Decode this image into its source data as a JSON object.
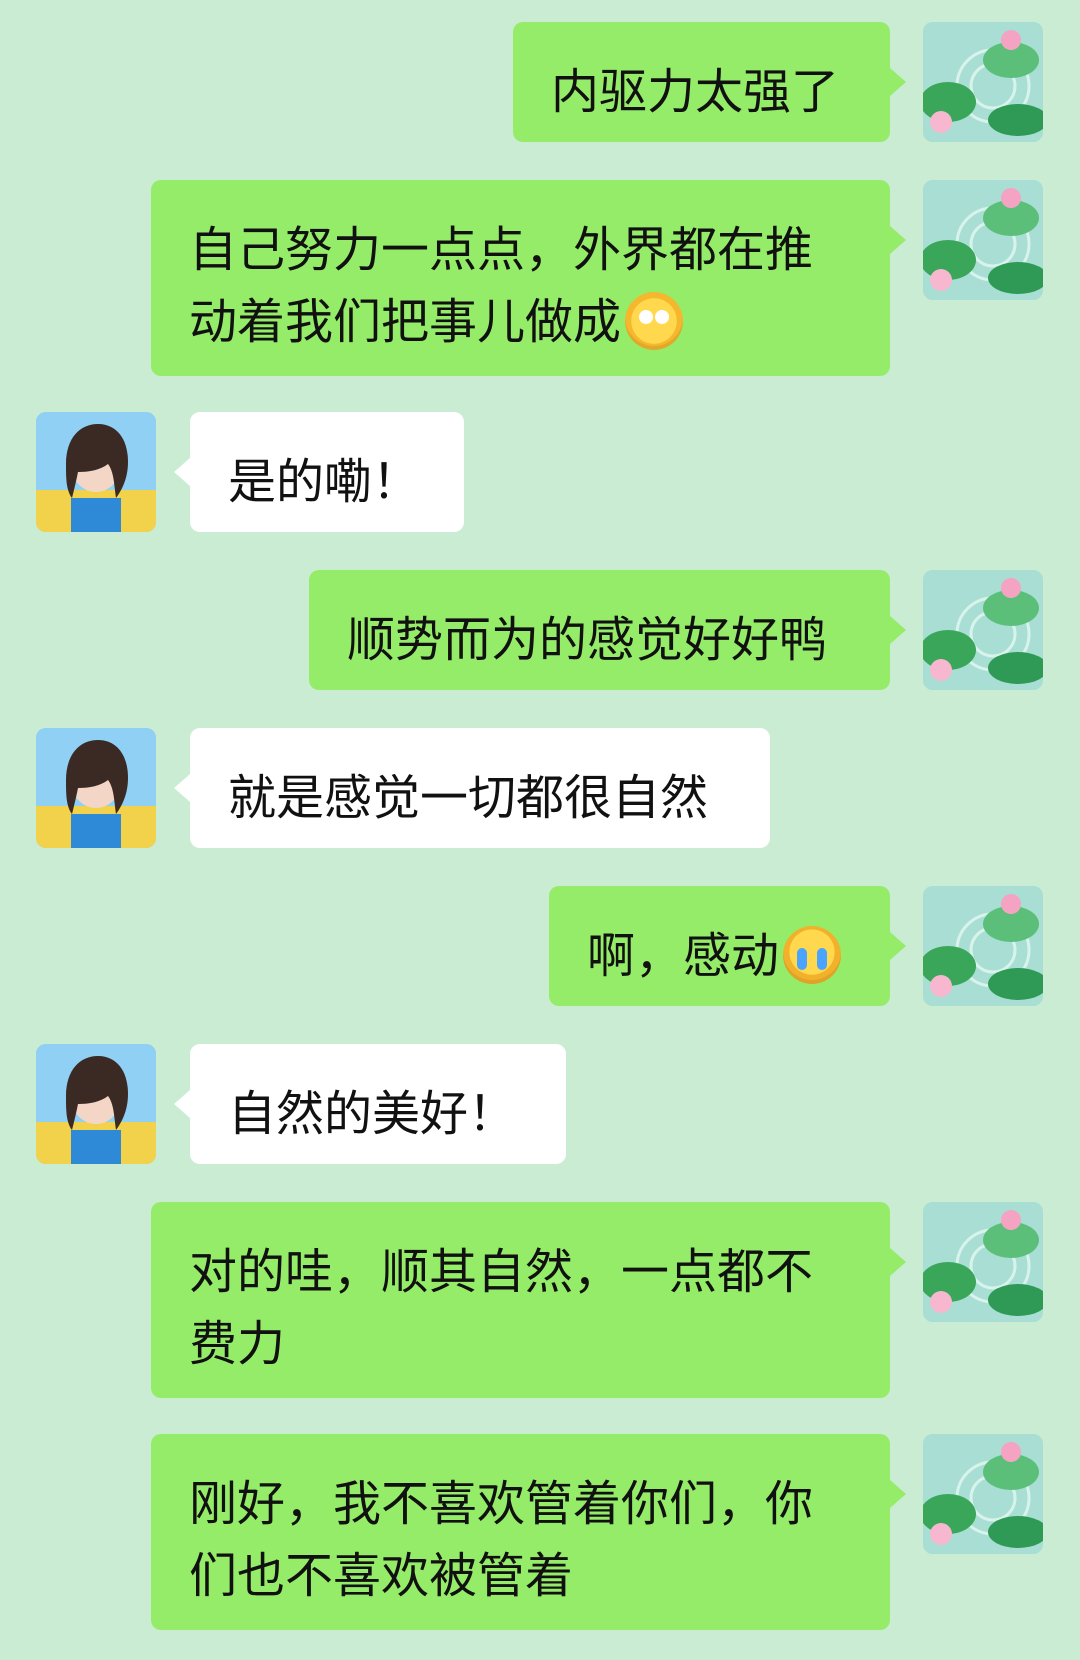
{
  "messages": [
    {
      "sender": "me",
      "text": "内驱力太强了",
      "avatar_icon": "lotus-pond-avatar-icon"
    },
    {
      "sender": "me",
      "text": "自己努力一点点，外界都在推动着我们把事儿做成",
      "emoji": "starry-eyed-emoji",
      "avatar_icon": "lotus-pond-avatar-icon"
    },
    {
      "sender": "other",
      "text": "是的嘞！",
      "avatar_icon": "girl-portrait-avatar-icon"
    },
    {
      "sender": "me",
      "text": "顺势而为的感觉好好鸭",
      "avatar_icon": "lotus-pond-avatar-icon"
    },
    {
      "sender": "other",
      "text": "就是感觉一切都很自然",
      "avatar_icon": "girl-portrait-avatar-icon"
    },
    {
      "sender": "me",
      "text": "啊，感动",
      "emoji": "crying-face-emoji",
      "avatar_icon": "lotus-pond-avatar-icon"
    },
    {
      "sender": "other",
      "text": "自然的美好！",
      "avatar_icon": "girl-portrait-avatar-icon"
    },
    {
      "sender": "me",
      "text": "对的哇，顺其自然，一点都不费力",
      "avatar_icon": "lotus-pond-avatar-icon"
    },
    {
      "sender": "me",
      "text": "刚好，我不喜欢管着你们，你们也不喜欢被管着",
      "avatar_icon": "lotus-pond-avatar-icon"
    }
  ],
  "colors": {
    "background": "#c9ecd2",
    "my_bubble": "#95ec69",
    "other_bubble": "#ffffff",
    "text": "#111111"
  }
}
